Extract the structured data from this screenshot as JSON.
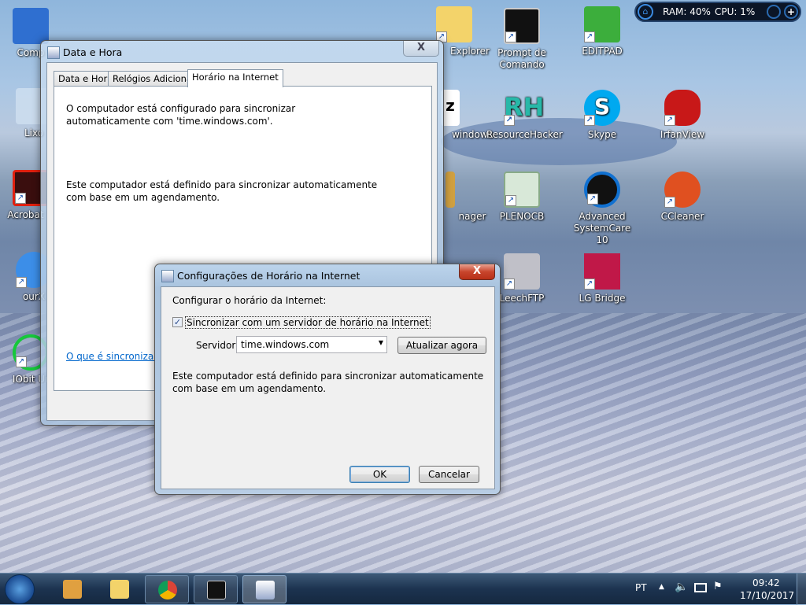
{
  "desktop_icons": [
    {
      "label": "Comp",
      "color": "#2f6fd0"
    },
    {
      "label": "Lixo",
      "color": "#cfe0f0"
    },
    {
      "label": "Acrobat D",
      "color": "#3a0e0e"
    },
    {
      "label": "ourX",
      "color": "#3c8ee8"
    },
    {
      "label": "IObit Ur",
      "color": "#16c83a"
    },
    {
      "label": "Explorer",
      "color": "#f3d36a"
    },
    {
      "label": "Prompt de Comando",
      "color": "#111111"
    },
    {
      "label": "EDITPAD",
      "color": "#3cae3c"
    },
    {
      "label": "windows",
      "color": "#ffffff"
    },
    {
      "label": "ResourceHacker",
      "color": "#27b8a8"
    },
    {
      "label": "Skype",
      "color": "#00a9f0"
    },
    {
      "label": "IrfanView",
      "color": "#c81818"
    },
    {
      "label": "nager",
      "color": "#d0a040"
    },
    {
      "label": "PLENOCB",
      "color": "#d8e8d8"
    },
    {
      "label": "Advanced SystemCare 10",
      "color": "#1070d0"
    },
    {
      "label": "CCleaner",
      "color": "#e05020"
    },
    {
      "label": "LeechFTP",
      "color": "#c0c0c8"
    },
    {
      "label": "LG Bridge",
      "color": "#c01848"
    }
  ],
  "gadget": {
    "ram": "RAM: 40%",
    "cpu": "CPU: 1%"
  },
  "main_window": {
    "title": "Data e Hora",
    "close": "X",
    "tabs": [
      "Data e Hora",
      "Relógios Adicionais",
      "Horário na Internet"
    ],
    "text1": "O computador está configurado para sincronizar automaticamente com 'time.windows.com'.",
    "text2": "Este computador está definido para sincronizar automaticamente com base em um agendamento.",
    "link": "O que é sincronização"
  },
  "dialog": {
    "title": "Configurações de Horário na Internet",
    "close": "X",
    "heading": "Configurar o horário da Internet:",
    "checkbox_label": "Sincronizar com um servidor de horário na Internet",
    "checked": true,
    "server_label": "Servidor:",
    "server_value": "time.windows.com",
    "update_button": "Atualizar agora",
    "status": "Este computador está definido para sincronizar automaticamente com base em um agendamento.",
    "ok": "OK",
    "cancel": "Cancelar"
  },
  "taskbar": {
    "lang": "PT",
    "time": "09:42",
    "date": "17/10/2017"
  }
}
